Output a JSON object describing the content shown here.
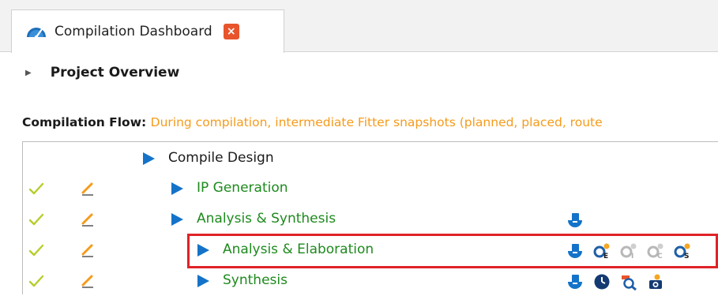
{
  "tab": {
    "title": "Compilation Dashboard",
    "close_label": "×",
    "icon": "speedometer-icon"
  },
  "overview": {
    "title": "Project Overview"
  },
  "flow": {
    "label": "Compilation Flow",
    "description": "During compilation, intermediate Fitter snapshots (planned, placed, route"
  },
  "tree": {
    "rows": [
      {
        "label": "Compile Design",
        "status": "",
        "color": "#1a1a1a"
      },
      {
        "label": "IP Generation",
        "status": "completed",
        "color": "#1d8a1d"
      },
      {
        "label": "Analysis & Synthesis",
        "status": "completed",
        "color": "#1d8a1d",
        "icons": [
          "report-icon"
        ]
      },
      {
        "label": "Analysis & Elaboration",
        "status": "completed",
        "color": "#1d8a1d",
        "icons": [
          "report-icon",
          "elaborated-netlist-icon",
          "interface-planner-icon",
          "compiled-netlist-icon",
          "synthesized-netlist-icon"
        ]
      },
      {
        "label": "Synthesis",
        "status": "completed",
        "color": "#1d8a1d",
        "icons": [
          "report-icon",
          "timing-analyzer-icon",
          "rtl-viewer-icon",
          "signal-tap-icon"
        ]
      }
    ]
  },
  "colors": {
    "accent": "#1473c9",
    "success": "#1d8a1d",
    "flow_note": "#f59b1b",
    "highlight": "#e02228"
  }
}
